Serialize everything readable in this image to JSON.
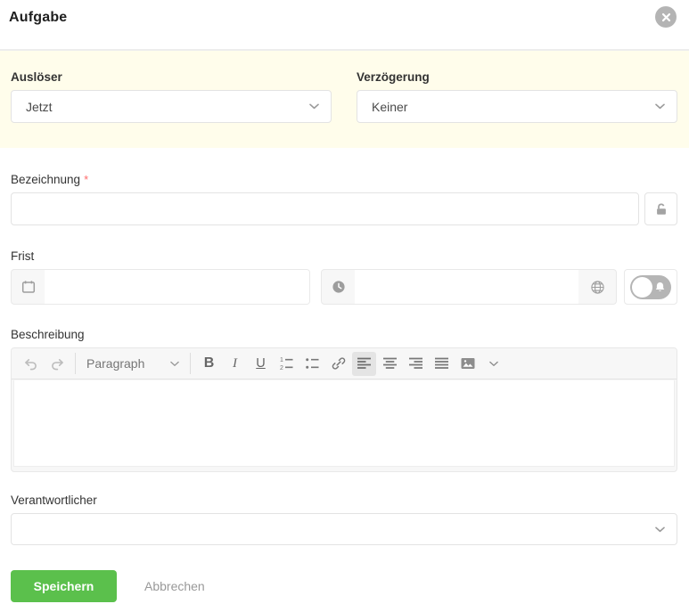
{
  "dialog": {
    "title": "Aufgabe"
  },
  "colors": {
    "accent_green": "#5bc04c",
    "highlight_background": "#fffdeb",
    "required_marker_red": "#ff6b6b",
    "close_button_gray": "#b4b4b4"
  },
  "trigger_field": {
    "label": "Auslöser",
    "value": "Jetzt"
  },
  "delay_field": {
    "label": "Verzögerung",
    "value": "Keiner"
  },
  "designation_field": {
    "label": "Bezeichnung",
    "required_marker": "*",
    "value": ""
  },
  "deadline_field": {
    "label": "Frist",
    "date_value": "",
    "time_value": "",
    "reminder_toggle_on": false
  },
  "description_field": {
    "label": "Beschreibung",
    "value": "",
    "toolbar": {
      "paragraph_label": "Paragraph",
      "bold_label": "B",
      "italic_label": "I",
      "underline_label": "U",
      "icons": [
        "undo-icon",
        "redo-icon",
        "numbered-list-icon",
        "bullet-list-icon",
        "link-icon",
        "align-left-icon",
        "align-center-icon",
        "align-right-icon",
        "justify-icon",
        "image-icon",
        "more-options-icon"
      ],
      "active_alignment": "align-left"
    }
  },
  "responsible_field": {
    "label": "Verantwortlicher",
    "value": ""
  },
  "actions": {
    "save_label": "Speichern",
    "cancel_label": "Abbrechen"
  },
  "icons": {
    "close": "x-in-circle",
    "designation_lock": "lock-open",
    "date": "calendar",
    "time": "clock",
    "timezone": "globe",
    "reminder": "bell",
    "dropdown": "chevron-down"
  }
}
